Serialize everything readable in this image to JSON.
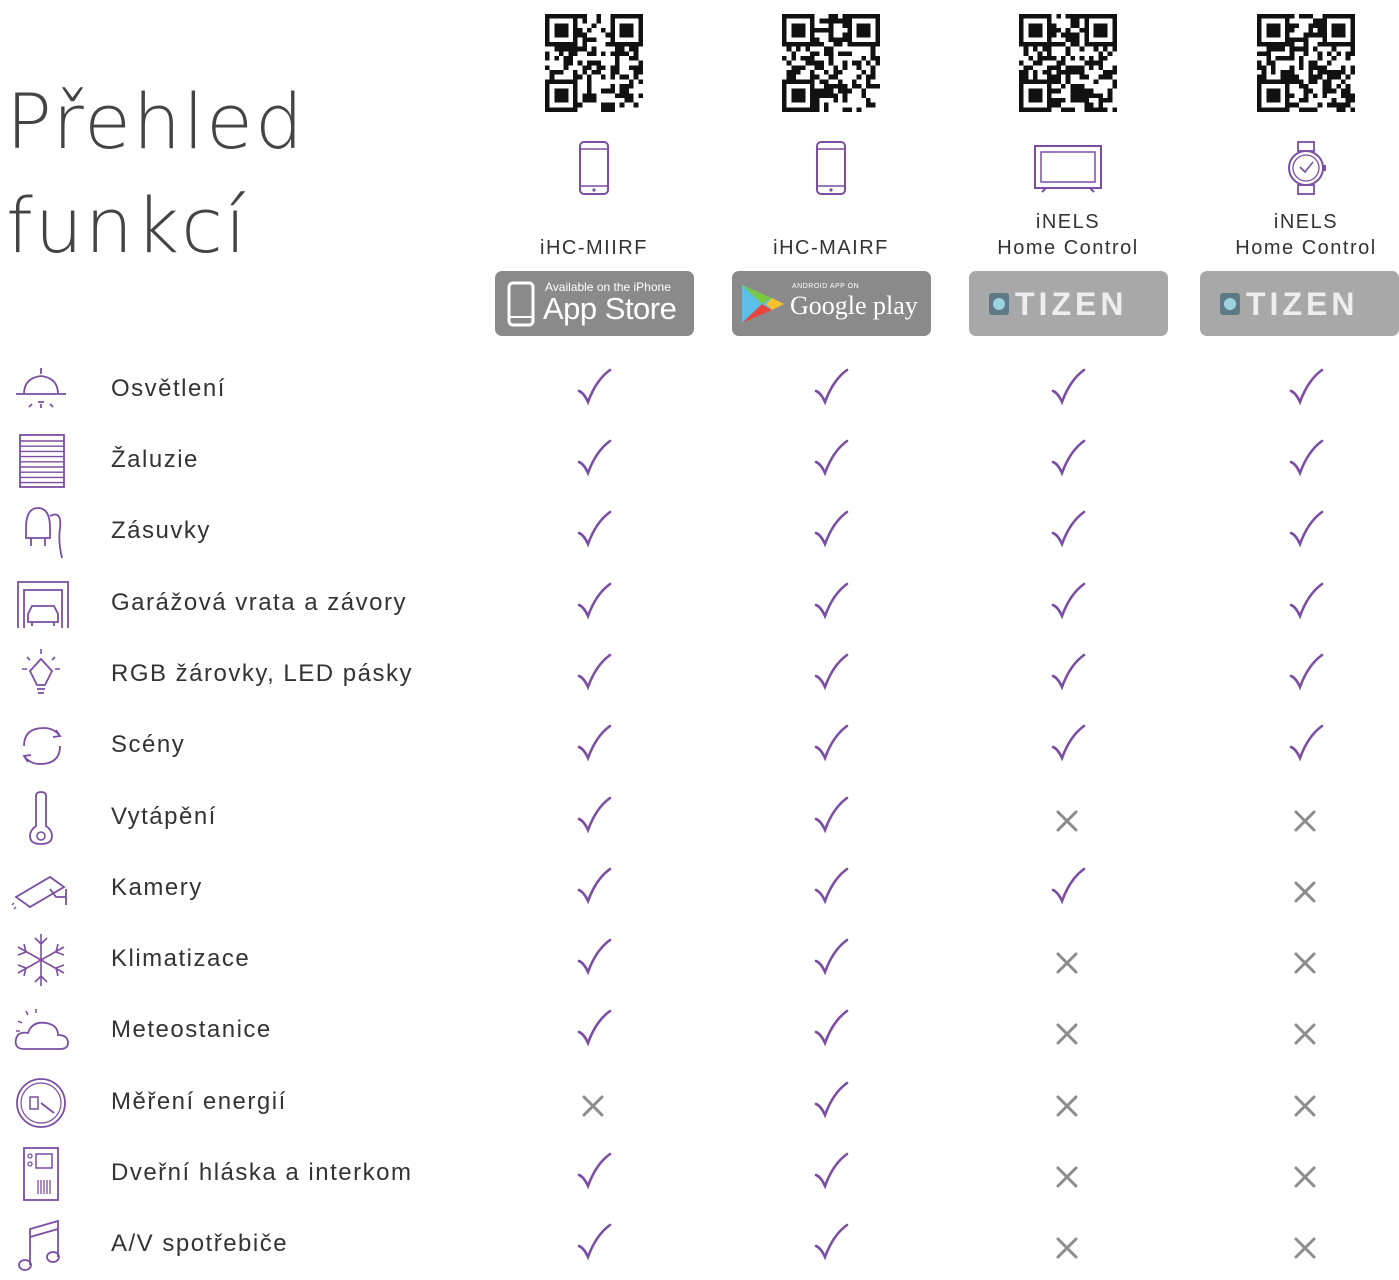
{
  "title": {
    "line1": "Přehled",
    "line2": "funkcí"
  },
  "columns": [
    {
      "name_line1": "",
      "name_line2": "iHC-MIIRF",
      "device": "phone-icon",
      "store": "app-store",
      "badge_small": "Available on the iPhone",
      "badge_big": "App Store"
    },
    {
      "name_line1": "",
      "name_line2": "iHC-MAIRF",
      "device": "phone-icon",
      "store": "google-play",
      "badge_small": "ANDROID APP ON",
      "badge_big": "Google play"
    },
    {
      "name_line1": "iNELS",
      "name_line2": "Home Control",
      "device": "tv-icon",
      "store": "tizen",
      "badge_small": "",
      "badge_big": "TIZEN"
    },
    {
      "name_line1": "iNELS",
      "name_line2": "Home Control",
      "device": "watch-icon",
      "store": "tizen",
      "badge_small": "",
      "badge_big": "TIZEN"
    }
  ],
  "colors": {
    "check": "#7b4ea3",
    "cross": "#8c8c8c",
    "icon": "#7b4ea3"
  },
  "features": [
    {
      "label": "Osvětlení",
      "icon": "lamp-icon",
      "support": [
        true,
        true,
        true,
        true
      ]
    },
    {
      "label": "Žaluzie",
      "icon": "blinds-icon",
      "support": [
        true,
        true,
        true,
        true
      ]
    },
    {
      "label": "Zásuvky",
      "icon": "plug-icon",
      "support": [
        true,
        true,
        true,
        true
      ]
    },
    {
      "label": "Garážová vrata a závory",
      "icon": "garage-icon",
      "support": [
        true,
        true,
        true,
        true
      ]
    },
    {
      "label": "RGB žárovky, LED pásky",
      "icon": "bulb-icon",
      "support": [
        true,
        true,
        true,
        true
      ]
    },
    {
      "label": "Scény",
      "icon": "scenes-icon",
      "support": [
        true,
        true,
        true,
        true
      ]
    },
    {
      "label": "Vytápění",
      "icon": "thermometer-icon",
      "support": [
        true,
        true,
        false,
        false
      ]
    },
    {
      "label": "Kamery",
      "icon": "camera-icon",
      "support": [
        true,
        true,
        true,
        false
      ]
    },
    {
      "label": "Klimatizace",
      "icon": "snowflake-icon",
      "support": [
        true,
        true,
        false,
        false
      ]
    },
    {
      "label": "Meteostanice",
      "icon": "weather-icon",
      "support": [
        true,
        true,
        false,
        false
      ]
    },
    {
      "label": "Měření energií",
      "icon": "energy-meter-icon",
      "support": [
        false,
        true,
        false,
        false
      ]
    },
    {
      "label": "Dveřní hláska a interkom",
      "icon": "intercom-icon",
      "support": [
        true,
        true,
        false,
        false
      ]
    },
    {
      "label": "A/V spotřebiče",
      "icon": "music-icon",
      "support": [
        true,
        true,
        false,
        false
      ]
    }
  ]
}
